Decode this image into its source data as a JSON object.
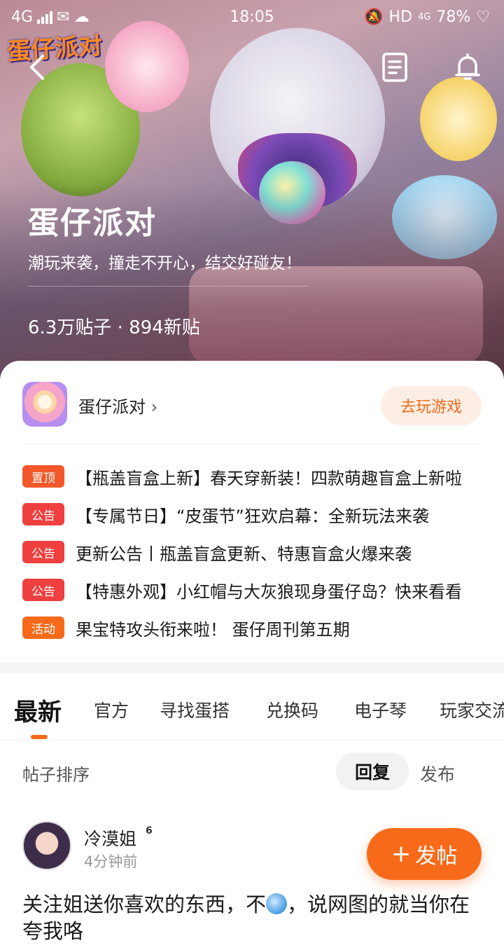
{
  "status_bar": {
    "network": "4G",
    "time": "18:05",
    "hd": "HD",
    "net2": "4G",
    "battery": "78%"
  },
  "hero": {
    "logo_text": "蛋仔派对",
    "title": "蛋仔派对",
    "subtitle": "潮玩来袭，撞走不开心，结交好碰友！",
    "stats": "6.3万贴子 · 894新贴"
  },
  "game": {
    "name": "蛋仔派对",
    "play_button": "去玩游戏"
  },
  "notices": [
    {
      "tag": "置顶",
      "tag_color": "#f2582a",
      "text": "【瓶盖盲盒上新】春天穿新装！四款萌趣盲盒上新啦"
    },
    {
      "tag": "公告",
      "tag_color": "#ef3f3f",
      "text": "【专属节日】“皮蛋节”狂欢启幕：全新玩法来袭"
    },
    {
      "tag": "公告",
      "tag_color": "#ef3f3f",
      "text": "更新公告丨瓶盖盲盒更新、特惠盲盒火爆来袭"
    },
    {
      "tag": "公告",
      "tag_color": "#ef3f3f",
      "text": "【特惠外观】小红帽与大灰狼现身蛋仔岛？快来看看"
    },
    {
      "tag": "活动",
      "tag_color": "#f76a1a",
      "text": "果宝特攻头衔来啦！ 蛋仔周刊第五期"
    }
  ],
  "tabs": [
    "最新",
    "官方",
    "寻找蛋搭",
    "兑换码",
    "电子琴",
    "玩家交流"
  ],
  "sort": {
    "label": "帖子排序",
    "reply": "回复",
    "publish": "发布"
  },
  "post": {
    "user": "冷漠姐",
    "level": "6",
    "time": "4分钟前",
    "body_part1": "关注姐送你喜欢的东西，不",
    "body_part2": "，说网图的就当你在夸我咯"
  },
  "fab": {
    "plus": "+",
    "label": "发帖"
  },
  "colors": {
    "accent": "#f76a1a",
    "notice_red": "#ef3f3f",
    "play_bg": "#fdeee5"
  }
}
